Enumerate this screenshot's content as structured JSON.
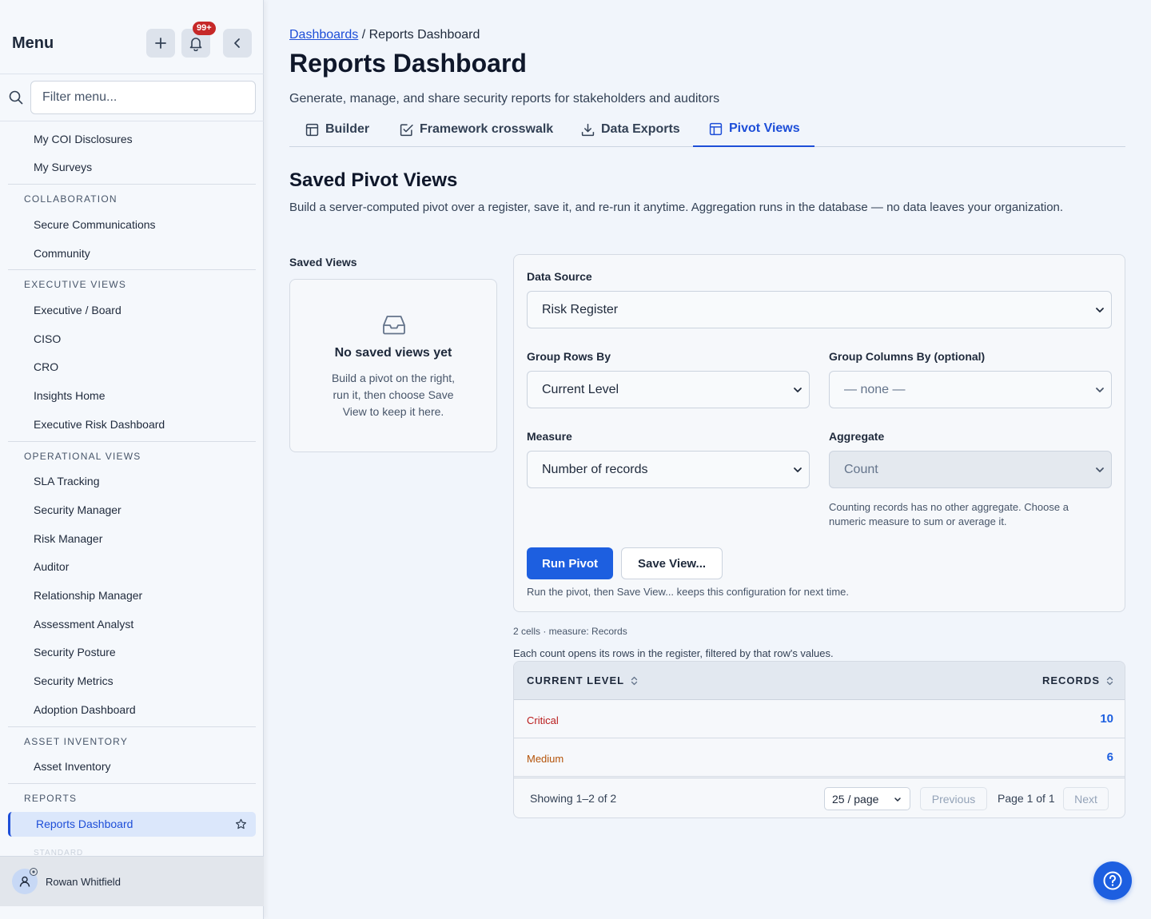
{
  "sidebar": {
    "title": "Menu",
    "notification_count": "99+",
    "filter_placeholder": "Filter menu...",
    "items": {
      "my_coi": "My COI Disclosures",
      "my_surveys": "My Surveys",
      "sec_collab": "COLLABORATION",
      "secure_comms": "Secure Communications",
      "community": "Community",
      "sec_exec": "EXECUTIVE VIEWS",
      "exec_board": "Executive / Board",
      "ciso": "CISO",
      "cro": "CRO",
      "insights_home": "Insights Home",
      "exec_risk": "Executive Risk Dashboard",
      "sec_ops": "OPERATIONAL VIEWS",
      "sla": "SLA Tracking",
      "sec_manager": "Security Manager",
      "risk_manager": "Risk Manager",
      "auditor": "Auditor",
      "rel_manager": "Relationship Manager",
      "assess_analyst": "Assessment Analyst",
      "sec_posture": "Security Posture",
      "sec_metrics": "Security Metrics",
      "adoption": "Adoption Dashboard",
      "sec_asset": "ASSET INVENTORY",
      "asset_inv": "Asset Inventory",
      "sec_reports": "REPORTS",
      "reports_dash": "Reports Dashboard",
      "sec_standard": "STANDARD"
    },
    "user_name": "Rowan Whitfield"
  },
  "header": {
    "breadcrumb_link": "Dashboards",
    "breadcrumb_sep": " / ",
    "breadcrumb_current": "Reports Dashboard",
    "title": "Reports Dashboard",
    "subtitle": "Generate, manage, and share security reports for stakeholders and auditors"
  },
  "tabs": [
    "Builder",
    "Framework crosswalk",
    "Data Exports",
    "Pivot Views"
  ],
  "active_tab": "Pivot Views",
  "section": {
    "title": "Saved Pivot Views",
    "description": "Build a server-computed pivot over a register, save it, and re-run it anytime. Aggregation runs in the database — no data leaves your organization."
  },
  "saved_views": {
    "label": "Saved Views",
    "empty_title": "No saved views yet",
    "empty_body": "Build a pivot on the right, run it, then choose Save View to keep it here."
  },
  "config": {
    "data_source_label": "Data Source",
    "data_source_value": "Risk Register",
    "group_rows_label": "Group Rows By",
    "group_rows_value": "Current Level",
    "group_cols_label": "Group Columns By (optional)",
    "group_cols_value": "— none —",
    "measure_label": "Measure",
    "measure_value": "Number of records",
    "aggregate_label": "Aggregate",
    "aggregate_value": "Count",
    "aggregate_help": "Counting records has no other aggregate. Choose a numeric measure to sum or average it.",
    "run_button": "Run Pivot",
    "save_button": "Save View...",
    "run_help": "Run the pivot, then Save View... keeps this configuration for next time."
  },
  "results": {
    "meta": "2 cells · measure: Records",
    "note": "Each count opens its rows in the register, filtered by that row's values.",
    "columns": [
      "CURRENT LEVEL",
      "RECORDS"
    ],
    "rows": [
      {
        "level": "Critical",
        "count": "10",
        "color": "#b91c1c"
      },
      {
        "level": "Medium",
        "count": "6",
        "color": "#b45309"
      }
    ],
    "showing": "Showing 1–2 of 2",
    "per_page": "25 / page",
    "previous": "Previous",
    "page_info": "Page 1 of 1",
    "next": "Next"
  },
  "colors": {
    "accent": "#1d5fe0",
    "critical": "#b91c1c",
    "medium": "#b45309",
    "badge": "#c62828"
  }
}
